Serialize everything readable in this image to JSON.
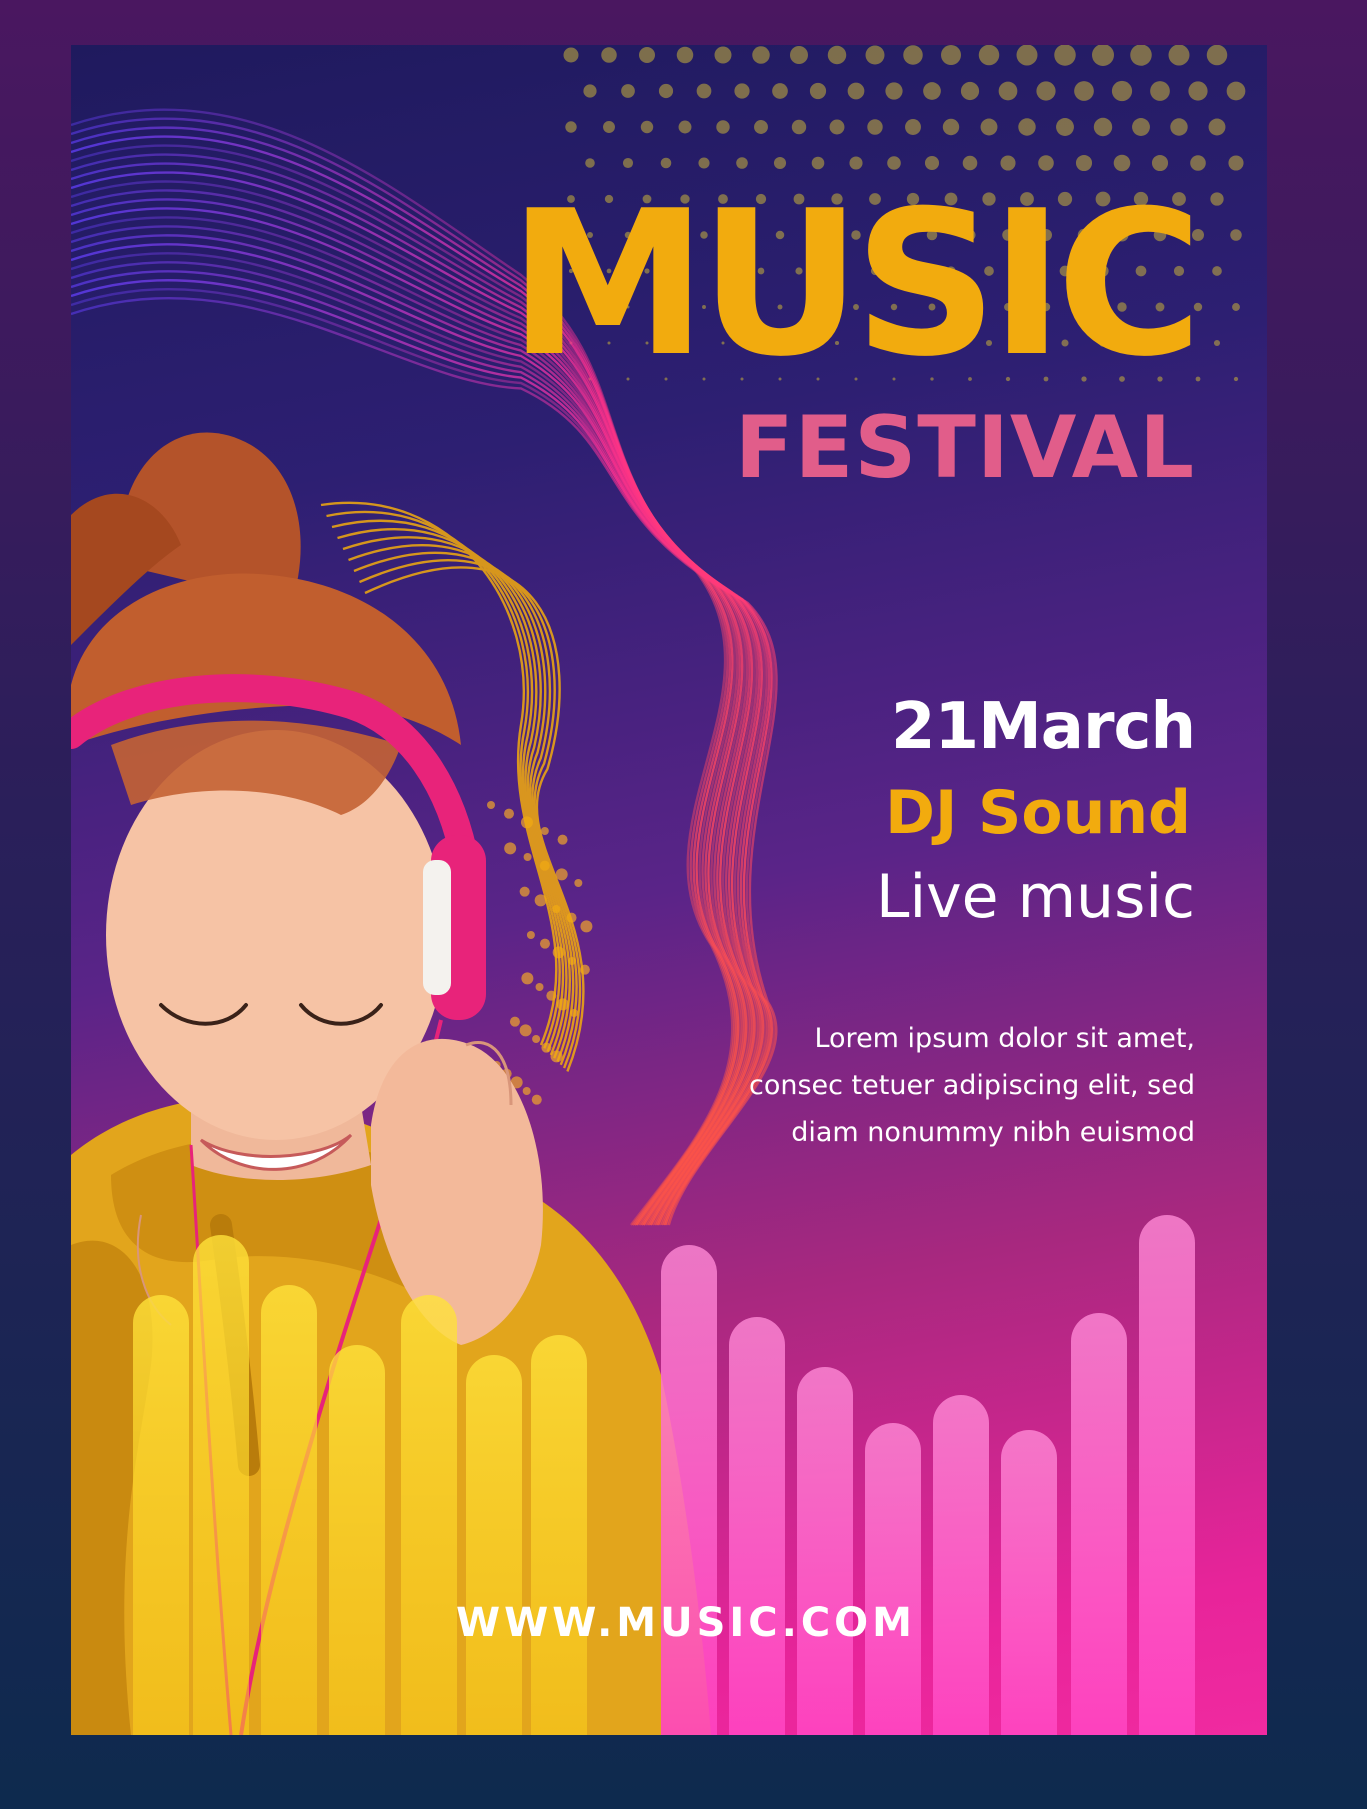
{
  "poster": {
    "title": "MUSIC",
    "subtitle": "FESTIVAL",
    "date": "21March",
    "performer": "DJ Sound",
    "event_type": "Live music",
    "description_lines": [
      "Lorem ipsum dolor sit amet,",
      "consec tetuer adipiscing elit, sed",
      "diam nonummy nibh euismod"
    ],
    "website": "WWW.MUSIC.COM"
  },
  "colors": {
    "accent_yellow": "#f2ab0e",
    "accent_pink": "#e15d8a",
    "hot_pink": "#f02aa0",
    "deep_blue": "#1f1a5e",
    "headphone_pink": "#e8237a",
    "hoodie_yellow": "#e2a51c",
    "hair_red": "#b4532a"
  },
  "icons": {
    "photo": "woman-with-headphones-image",
    "waves": "sound-wave-lines",
    "equalizer": "equalizer-bars"
  }
}
